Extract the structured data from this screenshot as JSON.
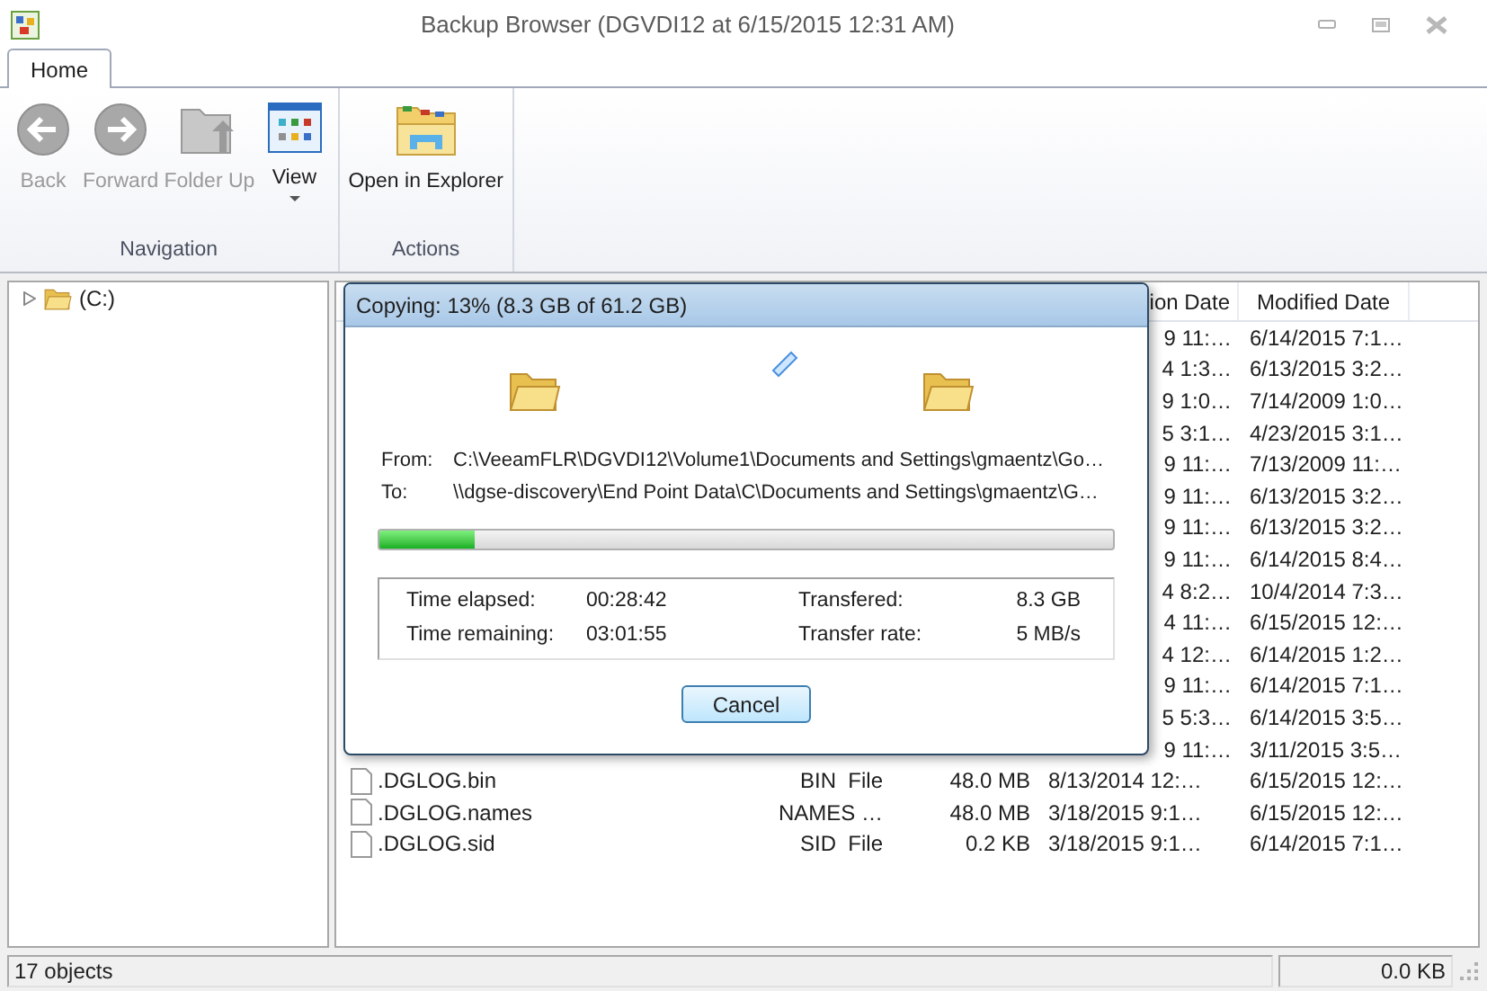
{
  "window": {
    "title": "Backup Browser (DGVDI12 at 6/15/2015 12:31 AM)"
  },
  "tabs": [
    {
      "label": "Home",
      "selected": true
    }
  ],
  "ribbon": {
    "groups": [
      {
        "label": "Navigation",
        "buttons": [
          {
            "kind": "back",
            "label": "Back",
            "disabled": true
          },
          {
            "kind": "forward",
            "label": "Forward",
            "disabled": true
          },
          {
            "kind": "folder-up",
            "label": "Folder Up",
            "disabled": true
          },
          {
            "kind": "view",
            "label": "View",
            "disabled": false,
            "dropdown": true
          }
        ]
      },
      {
        "label": "Actions",
        "buttons": [
          {
            "kind": "explorer",
            "label": "Open in Explorer",
            "disabled": false
          }
        ]
      }
    ]
  },
  "tree": [
    {
      "label": "(C:)",
      "expanded": false
    }
  ],
  "file_list": {
    "columns": [
      {
        "label": "ion Date"
      },
      {
        "label": "Modified Date"
      }
    ],
    "rows": [
      {
        "created": "9 11:…",
        "modified": "6/14/2015 7:1…"
      },
      {
        "created": "4 1:3…",
        "modified": "6/13/2015 3:2…"
      },
      {
        "created": "9 1:0…",
        "modified": "7/14/2009 1:0…"
      },
      {
        "created": "5 3:1…",
        "modified": "4/23/2015 3:1…"
      },
      {
        "created": "9 11:…",
        "modified": "7/13/2009 11:…"
      },
      {
        "created": "9 11:…",
        "modified": "6/13/2015 3:2…"
      },
      {
        "created": "9 11:…",
        "modified": "6/13/2015 3:2…"
      },
      {
        "created": "9 11:…",
        "modified": "6/14/2015 8:4…"
      },
      {
        "created": "4 8:2…",
        "modified": "10/4/2014 7:3…"
      },
      {
        "created": "4 11:…",
        "modified": "6/15/2015 12:…"
      },
      {
        "created": "4 12:…",
        "modified": "6/14/2015 1:2…"
      },
      {
        "created": "9 11:…",
        "modified": "6/14/2015 7:1…"
      },
      {
        "created": "5 5:3…",
        "modified": "6/14/2015 3:5…"
      },
      {
        "created": "9 11:…",
        "modified": "3/11/2015 3:5…"
      },
      {
        "name": ".DGLOG.bin",
        "type": "BIN  File",
        "size": "48.0 MB",
        "created": "8/13/2014 12:…",
        "modified": "6/15/2015 12:…"
      },
      {
        "name": ".DGLOG.names",
        "type": "NAMES …",
        "size": "48.0 MB",
        "created": "3/18/2015 9:1…",
        "modified": "6/15/2015 12:…"
      },
      {
        "name": ".DGLOG.sid",
        "type": "SID  File",
        "size": "0.2 KB",
        "created": "3/18/2015 9:1…",
        "modified": "6/14/2015 7:1…"
      }
    ]
  },
  "dialog": {
    "title": "Copying: 13% (8.3 GB of 61.2 GB)",
    "from_label": "From:",
    "from": "C:\\VeeamFLR\\DGVDI12\\Volume1\\Documents and Settings\\gmaentz\\Go…",
    "to_label": "To:",
    "to": "\\\\dgse-discovery\\End Point Data\\C\\Documents and Settings\\gmaentz\\G…",
    "progress": {
      "level": 0.13
    },
    "stats": [
      {
        "label": "Time elapsed:",
        "value": "00:28:42"
      },
      {
        "label": "Transfered:",
        "value": "8.3 GB"
      },
      {
        "label": "Time remaining:",
        "value": "03:01:55"
      },
      {
        "label": "Transfer rate:",
        "value": "5 MB/s"
      }
    ],
    "cancel": "Cancel"
  },
  "status_bar": {
    "objects": "17 objects",
    "size": "0.0 KB"
  }
}
